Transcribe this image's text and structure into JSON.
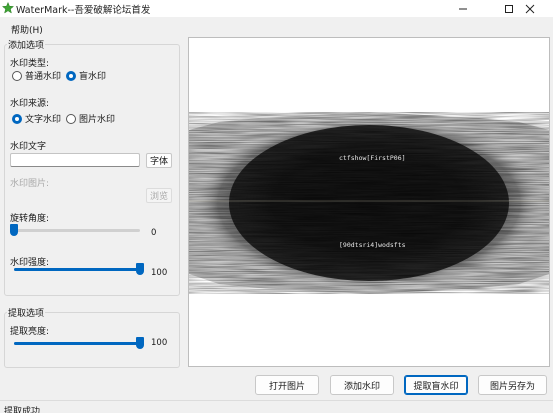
{
  "window": {
    "title": "WaterMark--吾爱破解论坛首发",
    "minimize_label": "—",
    "maximize_label": "☐",
    "close_label": "✕"
  },
  "menu": {
    "help": "帮助(H)"
  },
  "add_group": {
    "title": "添加选项",
    "type_label": "水印类型:",
    "type_options": [
      "普通水印",
      "盲水印"
    ],
    "type_selected": "盲水印",
    "source_label": "水印来源:",
    "source_options": [
      "文字水印",
      "图片水印"
    ],
    "source_selected": "文字水印",
    "text_label": "水印文字",
    "text_value": "",
    "font_button": "字体",
    "image_label": "水印图片:",
    "browse_button": "浏览",
    "rotation_label": "旋转角度:",
    "rotation_value": "0",
    "rotation_fraction": 0.0,
    "strength_label": "水印强度:",
    "strength_value": "100",
    "strength_fraction": 1.0
  },
  "extract_group": {
    "title": "提取选项",
    "brightness_label": "提取亮度:",
    "brightness_value": "100",
    "brightness_fraction": 1.0
  },
  "preview": {
    "top_text": "ctfshow[FirstP06]",
    "bottom_text": "[90dtsri4]wodsfts"
  },
  "actions": {
    "open_image": "打开图片",
    "add_watermark": "添加水印",
    "extract_blind": "提取盲水印",
    "save_as": "图片另存为"
  },
  "status": {
    "text": "提取成功"
  },
  "colors": {
    "accent": "#0067c0",
    "icon": "#3fa535"
  }
}
